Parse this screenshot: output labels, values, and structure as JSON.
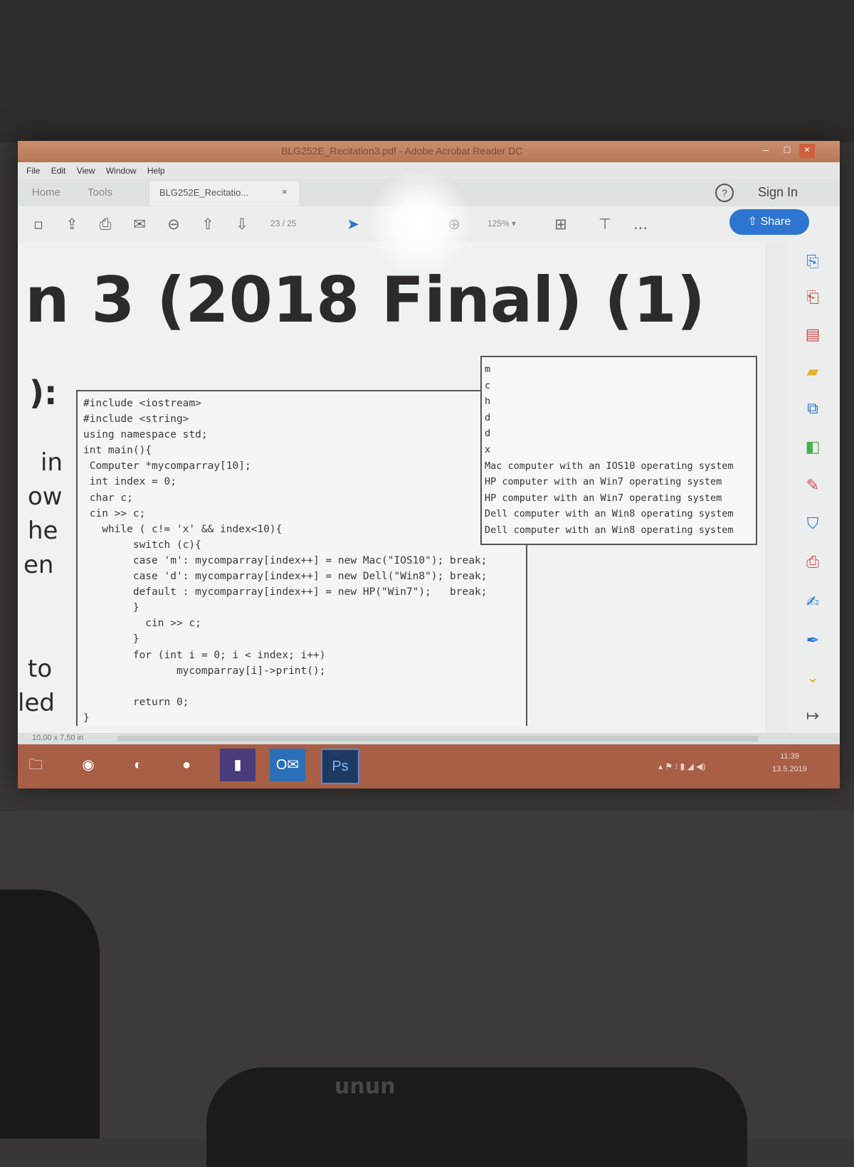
{
  "window": {
    "title": "BLG252E_Recitation3.pdf - Adobe Acrobat Reader DC"
  },
  "menu": [
    "File",
    "Edit",
    "View",
    "Window",
    "Help"
  ],
  "tabs": {
    "home": "Home",
    "tools": "Tools",
    "document": "BLG252E_Recitatio...",
    "close": "×"
  },
  "header": {
    "help": "?",
    "sign_in": "Sign In"
  },
  "toolbar": {
    "page_current": "23",
    "page_total": "/ 25",
    "zoom": "125%",
    "more": "...",
    "share": "Share"
  },
  "document": {
    "heading": "n 3 (2018 Final) (1)",
    "side_fragments": [
      "):",
      "in",
      "ow",
      "he",
      "en",
      "to",
      "led"
    ],
    "code": "#include <iostream>\n#include <string>\nusing namespace std;\nint main(){\n Computer *mycomparray[10];\n int index = 0;\n char c;\n cin >> c;\n   while ( c!= 'x' && index<10){\n        switch (c){\n        case 'm': mycomparray[index++] = new Mac(\"IOS10\"); break;\n        case 'd': mycomparray[index++] = new Dell(\"Win8\"); break;\n        default : mycomparray[index++] = new HP(\"Win7\");   break;\n        }\n          cin >> c;\n        }\n        for (int i = 0; i < index; i++)\n               mycomparray[i]->print();\n\n        return 0;\n}",
    "output": "m\nc\nh\nd\nd\nx\nMac computer with an IOS10 operating system\nHP computer with an Win7 operating system\nHP computer with an Win7 operating system\nDell computer with an Win8 operating system\nDell computer with an Win8 operating system"
  },
  "status": {
    "page_size": "10,00 x 7,50 in"
  },
  "taskbar": {
    "clock_time": "11:39",
    "clock_date": "13.5.2019",
    "apps": [
      "file-explorer",
      "chrome",
      "eclipse",
      "firefox",
      "visual-studio",
      "outlook",
      "photoshop"
    ]
  },
  "colors": {
    "accent": "#2e74d1",
    "titlebar": "#b97655",
    "taskbar": "#a85f46",
    "tool_red": "#d24a4a"
  }
}
